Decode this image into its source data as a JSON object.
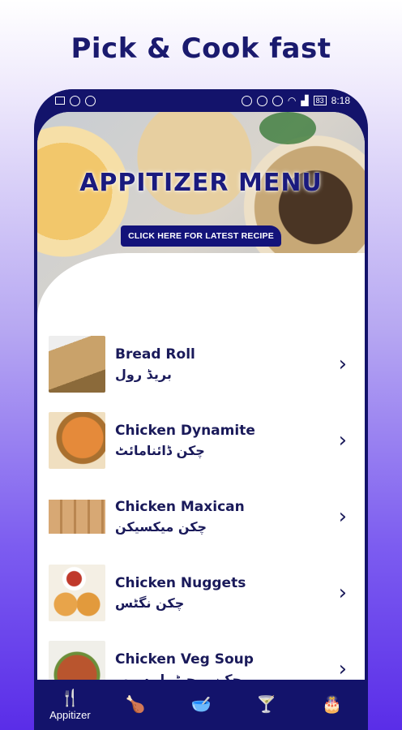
{
  "promo": {
    "title": "Pick & Cook fast"
  },
  "status_bar": {
    "battery": "83",
    "time": "8:18"
  },
  "hero": {
    "title": "APPITIZER MENU",
    "button_label": "CLICK HERE FOR LATEST RECIPE"
  },
  "recipes": [
    {
      "name_en": "Bread Roll",
      "name_ur": "بریڈ رول",
      "thumb_color": "#c9a26a"
    },
    {
      "name_en": "Chicken Dynamite",
      "name_ur": "چکن ڈائنامائٹ",
      "thumb_color": "#d98a3a"
    },
    {
      "name_en": "Chicken Maxican",
      "name_ur": "چکن میکسیکن",
      "thumb_color": "#d7a874"
    },
    {
      "name_en": "Chicken Nuggets",
      "name_ur": "چکن نگٹس",
      "thumb_color": "#e2a24a"
    },
    {
      "name_en": "Chicken Veg Soup",
      "name_ur": "چکن ویجیٹیبل سوپ",
      "thumb_color": "#b9552e"
    }
  ],
  "bottom_nav": {
    "items": [
      {
        "label": "Appitizer",
        "icon": "fork-knife-icon"
      },
      {
        "label": "",
        "icon": "chicken-icon"
      },
      {
        "label": "",
        "icon": "bowl-icon"
      },
      {
        "label": "",
        "icon": "drink-icon"
      },
      {
        "label": "",
        "icon": "cake-icon"
      }
    ]
  },
  "colors": {
    "primary": "#13136b",
    "text": "#1a1a5a"
  }
}
